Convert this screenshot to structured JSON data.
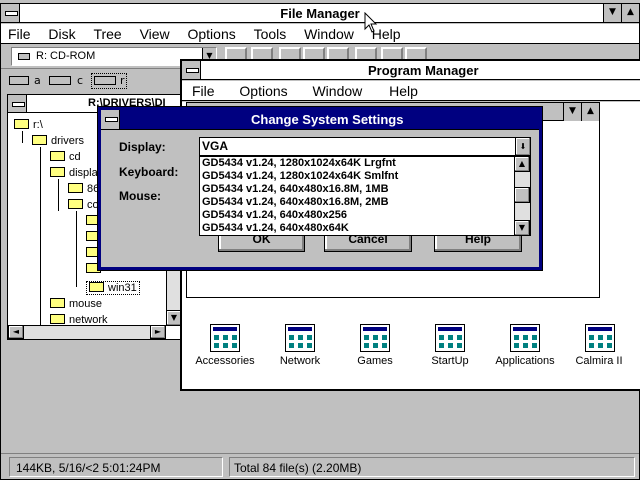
{
  "file_manager": {
    "title": "File Manager",
    "menu": [
      "File",
      "Disk",
      "Tree",
      "View",
      "Options",
      "Tools",
      "Window",
      "Help"
    ],
    "drive_select": "R: CD-ROM",
    "drives": [
      {
        "letter": "a",
        "icon": "floppy-drive-icon"
      },
      {
        "letter": "c",
        "icon": "hard-drive-icon"
      },
      {
        "letter": "r",
        "icon": "cdrom-drive-icon"
      }
    ],
    "tree_title": "R:\\DRIVERS\\DI",
    "tree": [
      {
        "label": "r:\\",
        "depth": 0
      },
      {
        "label": "drivers",
        "depth": 1
      },
      {
        "label": "cd",
        "depth": 2
      },
      {
        "label": "display",
        "depth": 2
      },
      {
        "label": "86",
        "depth": 3
      },
      {
        "label": "co",
        "depth": 3
      },
      {
        "label": "",
        "depth": 4
      },
      {
        "label": "",
        "depth": 4
      },
      {
        "label": "",
        "depth": 4
      },
      {
        "label": "",
        "depth": 4
      },
      {
        "label": "win31",
        "depth": 4
      },
      {
        "label": "mouse",
        "depth": 2
      },
      {
        "label": "network",
        "depth": 2
      }
    ],
    "status_left": "144KB, 5/16/<2 5:01:24PM",
    "status_right": "Total 84 file(s) (2.20MB)"
  },
  "program_manager": {
    "title": "Program Manager",
    "menu": [
      "File",
      "Options",
      "Window",
      "Help"
    ],
    "groups": [
      {
        "label": "Accessories",
        "icon": "program-group-icon"
      },
      {
        "label": "Network",
        "icon": "program-group-icon"
      },
      {
        "label": "Games",
        "icon": "program-group-icon"
      },
      {
        "label": "StartUp",
        "icon": "program-group-icon"
      },
      {
        "label": "Applications",
        "icon": "program-group-icon"
      },
      {
        "label": "Calmira II",
        "icon": "program-group-icon"
      }
    ]
  },
  "dialog": {
    "title": "Change System Settings",
    "display_label": "Display:",
    "keyboard_label": "Keyboard:",
    "mouse_label": "Mouse:",
    "display_value": "VGA",
    "options": [
      "GD5434 v1.24, 1280x1024x64K Lrgfnt",
      "GD5434 v1.24, 1280x1024x64K Smlfnt",
      "GD5434 v1.24, 640x480x16.8M, 1MB",
      "GD5434 v1.24, 640x480x16.8M, 2MB",
      "GD5434 v1.24, 640x480x256",
      "GD5434 v1.24, 640x480x64K"
    ],
    "ok": "OK",
    "cancel": "Cancel",
    "help": "Help"
  }
}
